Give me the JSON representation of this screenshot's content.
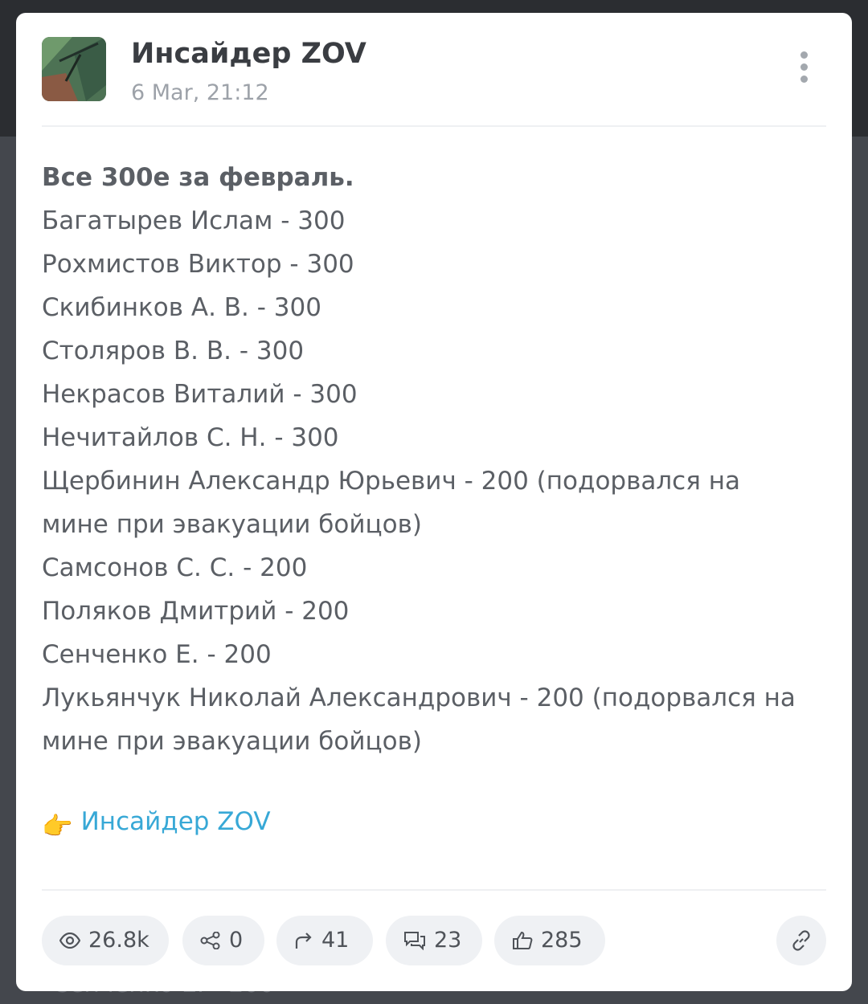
{
  "post": {
    "channel_name": "Инсайдер ZOV",
    "date": "6 Mar, 21:12",
    "heading": "Все 300е за февраль.",
    "lines": [
      "Багатырев Ислам - 300",
      "Рохмистов Виктор - 300",
      "Скибинков А. В. - 300",
      "Столяров В. В. - 300",
      "Некрасов Виталий - 300",
      "Нечитайлов С. Н. - 300",
      "Щербинин Александр Юрьевич - 200 (подорвался на мине при эвакуации бойцов)",
      "Самсонов С. С. - 200",
      "Поляков Дмитрий - 200",
      "Сенченко Е. - 200",
      "Лукьянчук Николай Александрович - 200 (подорвался на мине при эвакуации бойцов)"
    ],
    "signature_emoji": "👉",
    "signature_link": "Инсайдер ZOV"
  },
  "stats": {
    "views": "26.8k",
    "shares": "0",
    "forwards": "41",
    "comments": "23",
    "likes": "285"
  },
  "background_peek_text": "Сенченко Е. - 200",
  "colors": {
    "page_background": "#44474d",
    "top_band": "#2b2d31",
    "card": "#ffffff",
    "text": "#5b5f65",
    "muted": "#9da2a9",
    "link": "#37a8d6",
    "pill": "#eff1f4"
  },
  "icons": {
    "more": "vertical-dots-icon",
    "views": "eye-icon",
    "shares": "share-nodes-icon",
    "forwards": "forward-arrow-icon",
    "comments": "comments-icon",
    "likes": "thumbs-up-icon",
    "link": "link-icon"
  }
}
